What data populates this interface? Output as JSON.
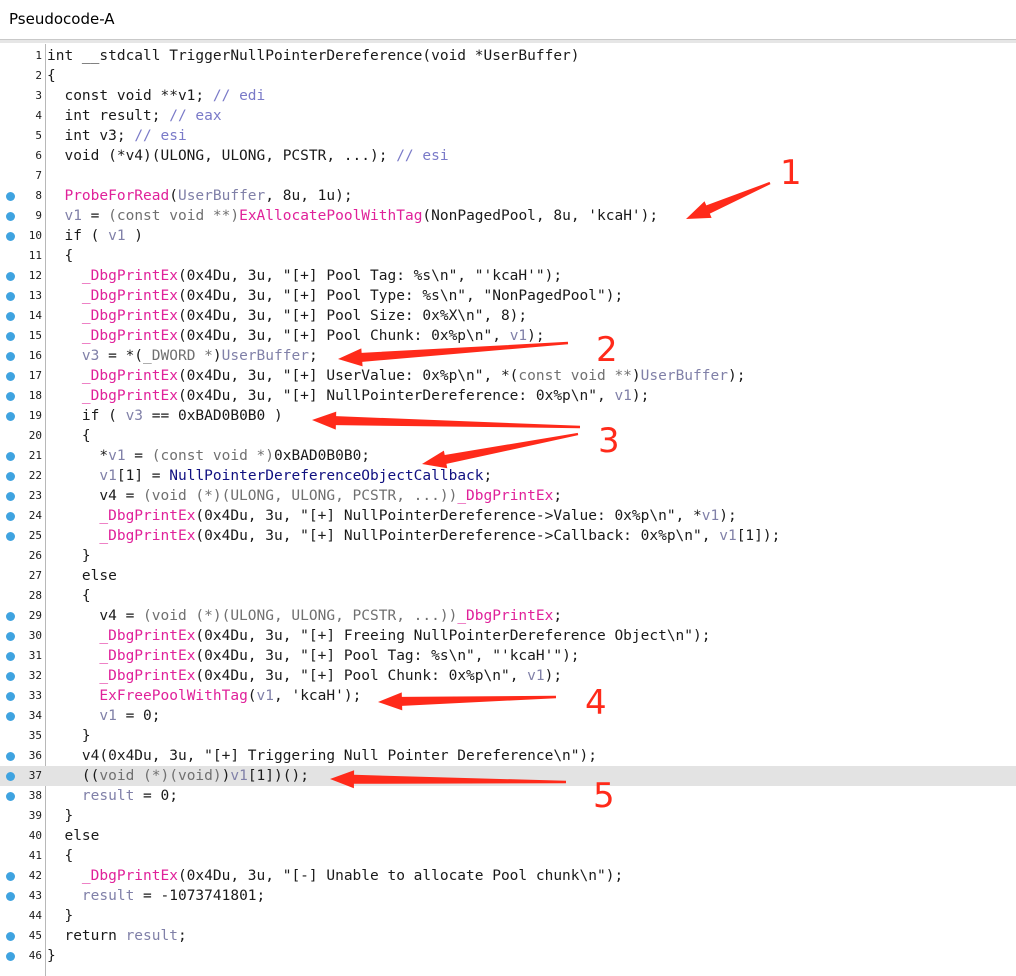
{
  "window": {
    "title": "Pseudocode-A"
  },
  "colors": {
    "breakpoint": "#3fa3e0",
    "function": "#e0219a",
    "variable": "#8080a8",
    "comment": "#7a7ac8",
    "annotation_red": "#ff2a1a",
    "current_line": "#e3e3e3"
  },
  "lines": [
    {
      "n": "1",
      "bp": false,
      "tokens": [
        [
          "kw",
          "int __stdcall TriggerNullPointerDereference(void *UserBuffer)"
        ]
      ]
    },
    {
      "n": "2",
      "bp": false,
      "tokens": [
        [
          "kw",
          "{"
        ]
      ]
    },
    {
      "n": "3",
      "bp": false,
      "tokens": [
        [
          "kw",
          "  const void **v1; "
        ],
        [
          "cmt",
          "// edi"
        ]
      ]
    },
    {
      "n": "4",
      "bp": false,
      "tokens": [
        [
          "kw",
          "  int result; "
        ],
        [
          "cmt",
          "// eax"
        ]
      ]
    },
    {
      "n": "5",
      "bp": false,
      "tokens": [
        [
          "kw",
          "  int v3; "
        ],
        [
          "cmt",
          "// esi"
        ]
      ]
    },
    {
      "n": "6",
      "bp": false,
      "tokens": [
        [
          "kw",
          "  void (*v4)(ULONG, ULONG, PCSTR, ...); "
        ],
        [
          "cmt",
          "// esi"
        ]
      ]
    },
    {
      "n": "7",
      "bp": false,
      "tokens": [
        [
          "kw",
          ""
        ]
      ]
    },
    {
      "n": "8",
      "bp": true,
      "tokens": [
        [
          "kw",
          "  "
        ],
        [
          "fn",
          "ProbeForRead"
        ],
        [
          "kw",
          "("
        ],
        [
          "var",
          "UserBuffer"
        ],
        [
          "kw",
          ", 8u, 1u);"
        ]
      ]
    },
    {
      "n": "9",
      "bp": true,
      "tokens": [
        [
          "kw",
          "  "
        ],
        [
          "var",
          "v1"
        ],
        [
          "kw",
          " = "
        ],
        [
          "cast",
          "(const void **)"
        ],
        [
          "fn",
          "ExAllocatePoolWithTag"
        ],
        [
          "kw",
          "(NonPagedPool, 8u, 'kcaH');"
        ]
      ]
    },
    {
      "n": "10",
      "bp": true,
      "tokens": [
        [
          "kw",
          "  if ( "
        ],
        [
          "var",
          "v1"
        ],
        [
          "kw",
          " )"
        ]
      ]
    },
    {
      "n": "11",
      "bp": false,
      "tokens": [
        [
          "kw",
          "  {"
        ]
      ]
    },
    {
      "n": "12",
      "bp": true,
      "tokens": [
        [
          "kw",
          "    "
        ],
        [
          "fn",
          "_DbgPrintEx"
        ],
        [
          "kw",
          "(0x4Du, 3u, \"[+] Pool Tag: %s\\n\", \"'kcaH'\");"
        ]
      ]
    },
    {
      "n": "13",
      "bp": true,
      "tokens": [
        [
          "kw",
          "    "
        ],
        [
          "fn",
          "_DbgPrintEx"
        ],
        [
          "kw",
          "(0x4Du, 3u, \"[+] Pool Type: %s\\n\", \"NonPagedPool\");"
        ]
      ]
    },
    {
      "n": "14",
      "bp": true,
      "tokens": [
        [
          "kw",
          "    "
        ],
        [
          "fn",
          "_DbgPrintEx"
        ],
        [
          "kw",
          "(0x4Du, 3u, \"[+] Pool Size: 0x%X\\n\", 8);"
        ]
      ]
    },
    {
      "n": "15",
      "bp": true,
      "tokens": [
        [
          "kw",
          "    "
        ],
        [
          "fn",
          "_DbgPrintEx"
        ],
        [
          "kw",
          "(0x4Du, 3u, \"[+] Pool Chunk: 0x%p\\n\", "
        ],
        [
          "var",
          "v1"
        ],
        [
          "kw",
          ");"
        ]
      ]
    },
    {
      "n": "16",
      "bp": true,
      "tokens": [
        [
          "kw",
          "    "
        ],
        [
          "var",
          "v3"
        ],
        [
          "kw",
          " = *("
        ],
        [
          "cast",
          "_DWORD *"
        ],
        [
          "kw",
          ")"
        ],
        [
          "var",
          "UserBuffer"
        ],
        [
          "kw",
          ";"
        ]
      ]
    },
    {
      "n": "17",
      "bp": true,
      "tokens": [
        [
          "kw",
          "    "
        ],
        [
          "fn",
          "_DbgPrintEx"
        ],
        [
          "kw",
          "(0x4Du, 3u, \"[+] UserValue: 0x%p\\n\", *("
        ],
        [
          "cast",
          "const void **"
        ],
        [
          "kw",
          ")"
        ],
        [
          "var",
          "UserBuffer"
        ],
        [
          "kw",
          ");"
        ]
      ]
    },
    {
      "n": "18",
      "bp": true,
      "tokens": [
        [
          "kw",
          "    "
        ],
        [
          "fn",
          "_DbgPrintEx"
        ],
        [
          "kw",
          "(0x4Du, 3u, \"[+] NullPointerDereference: 0x%p\\n\", "
        ],
        [
          "var",
          "v1"
        ],
        [
          "kw",
          ");"
        ]
      ]
    },
    {
      "n": "19",
      "bp": true,
      "tokens": [
        [
          "kw",
          "    if ( "
        ],
        [
          "var",
          "v3"
        ],
        [
          "kw",
          " == 0xBAD0B0B0 )"
        ]
      ]
    },
    {
      "n": "20",
      "bp": false,
      "tokens": [
        [
          "kw",
          "    {"
        ]
      ]
    },
    {
      "n": "21",
      "bp": true,
      "tokens": [
        [
          "kw",
          "      *"
        ],
        [
          "var",
          "v1"
        ],
        [
          "kw",
          " = "
        ],
        [
          "cast",
          "(const void *)"
        ],
        [
          "kw",
          "0xBAD0B0B0;"
        ]
      ]
    },
    {
      "n": "22",
      "bp": true,
      "tokens": [
        [
          "kw",
          "      "
        ],
        [
          "var",
          "v1"
        ],
        [
          "kw",
          "[1] = "
        ],
        [
          "sym",
          "NullPointerDereferenceObjectCallback"
        ],
        [
          "kw",
          ";"
        ]
      ]
    },
    {
      "n": "23",
      "bp": true,
      "tokens": [
        [
          "kw",
          "      v4 = "
        ],
        [
          "cast",
          "(void (*)(ULONG, ULONG, PCSTR, ...))"
        ],
        [
          "fn",
          "_DbgPrintEx"
        ],
        [
          "kw",
          ";"
        ]
      ]
    },
    {
      "n": "24",
      "bp": true,
      "tokens": [
        [
          "kw",
          "      "
        ],
        [
          "fn",
          "_DbgPrintEx"
        ],
        [
          "kw",
          "(0x4Du, 3u, \"[+] NullPointerDereference->Value: 0x%p\\n\", *"
        ],
        [
          "var",
          "v1"
        ],
        [
          "kw",
          ");"
        ]
      ]
    },
    {
      "n": "25",
      "bp": true,
      "tokens": [
        [
          "kw",
          "      "
        ],
        [
          "fn",
          "_DbgPrintEx"
        ],
        [
          "kw",
          "(0x4Du, 3u, \"[+] NullPointerDereference->Callback: 0x%p\\n\", "
        ],
        [
          "var",
          "v1"
        ],
        [
          "kw",
          "[1]);"
        ]
      ]
    },
    {
      "n": "26",
      "bp": false,
      "tokens": [
        [
          "kw",
          "    }"
        ]
      ]
    },
    {
      "n": "27",
      "bp": false,
      "tokens": [
        [
          "kw",
          "    else"
        ]
      ]
    },
    {
      "n": "28",
      "bp": false,
      "tokens": [
        [
          "kw",
          "    {"
        ]
      ]
    },
    {
      "n": "29",
      "bp": true,
      "tokens": [
        [
          "kw",
          "      v4 = "
        ],
        [
          "cast",
          "(void (*)(ULONG, ULONG, PCSTR, ...))"
        ],
        [
          "fn",
          "_DbgPrintEx"
        ],
        [
          "kw",
          ";"
        ]
      ]
    },
    {
      "n": "30",
      "bp": true,
      "tokens": [
        [
          "kw",
          "      "
        ],
        [
          "fn",
          "_DbgPrintEx"
        ],
        [
          "kw",
          "(0x4Du, 3u, \"[+] Freeing NullPointerDereference Object\\n\");"
        ]
      ]
    },
    {
      "n": "31",
      "bp": true,
      "tokens": [
        [
          "kw",
          "      "
        ],
        [
          "fn",
          "_DbgPrintEx"
        ],
        [
          "kw",
          "(0x4Du, 3u, \"[+] Pool Tag: %s\\n\", \"'kcaH'\");"
        ]
      ]
    },
    {
      "n": "32",
      "bp": true,
      "tokens": [
        [
          "kw",
          "      "
        ],
        [
          "fn",
          "_DbgPrintEx"
        ],
        [
          "kw",
          "(0x4Du, 3u, \"[+] Pool Chunk: 0x%p\\n\", "
        ],
        [
          "var",
          "v1"
        ],
        [
          "kw",
          ");"
        ]
      ]
    },
    {
      "n": "33",
      "bp": true,
      "tokens": [
        [
          "kw",
          "      "
        ],
        [
          "fn",
          "ExFreePoolWithTag"
        ],
        [
          "kw",
          "("
        ],
        [
          "var",
          "v1"
        ],
        [
          "kw",
          ", 'kcaH');"
        ]
      ]
    },
    {
      "n": "34",
      "bp": true,
      "tokens": [
        [
          "kw",
          "      "
        ],
        [
          "var",
          "v1"
        ],
        [
          "kw",
          " = 0;"
        ]
      ]
    },
    {
      "n": "35",
      "bp": false,
      "tokens": [
        [
          "kw",
          "    }"
        ]
      ]
    },
    {
      "n": "36",
      "bp": true,
      "tokens": [
        [
          "kw",
          "    v4(0x4Du, 3u, \"[+] Triggering Null Pointer Dereference\\n\");"
        ]
      ]
    },
    {
      "n": "37",
      "bp": true,
      "current": true,
      "tokens": [
        [
          "kw",
          "    (("
        ],
        [
          "cast",
          "void (*)(void)"
        ],
        [
          "kw",
          ")"
        ],
        [
          "var",
          "v1"
        ],
        [
          "kw",
          "[1])();"
        ]
      ]
    },
    {
      "n": "38",
      "bp": true,
      "tokens": [
        [
          "kw",
          "    "
        ],
        [
          "var",
          "result"
        ],
        [
          "kw",
          " = 0;"
        ]
      ]
    },
    {
      "n": "39",
      "bp": false,
      "tokens": [
        [
          "kw",
          "  }"
        ]
      ]
    },
    {
      "n": "40",
      "bp": false,
      "tokens": [
        [
          "kw",
          "  else"
        ]
      ]
    },
    {
      "n": "41",
      "bp": false,
      "tokens": [
        [
          "kw",
          "  {"
        ]
      ]
    },
    {
      "n": "42",
      "bp": true,
      "tokens": [
        [
          "kw",
          "    "
        ],
        [
          "fn",
          "_DbgPrintEx"
        ],
        [
          "kw",
          "(0x4Du, 3u, \"[-] Unable to allocate Pool chunk\\n\");"
        ]
      ]
    },
    {
      "n": "43",
      "bp": true,
      "tokens": [
        [
          "kw",
          "    "
        ],
        [
          "var",
          "result"
        ],
        [
          "kw",
          " = -1073741801;"
        ]
      ]
    },
    {
      "n": "44",
      "bp": false,
      "tokens": [
        [
          "kw",
          "  }"
        ]
      ]
    },
    {
      "n": "45",
      "bp": true,
      "tokens": [
        [
          "kw",
          "  return "
        ],
        [
          "var",
          "result"
        ],
        [
          "kw",
          ";"
        ]
      ]
    },
    {
      "n": "46",
      "bp": true,
      "tokens": [
        [
          "kw",
          "}"
        ]
      ]
    }
  ],
  "annotations": [
    {
      "label": "1"
    },
    {
      "label": "2"
    },
    {
      "label": "3"
    },
    {
      "label": "4"
    },
    {
      "label": "5"
    }
  ]
}
